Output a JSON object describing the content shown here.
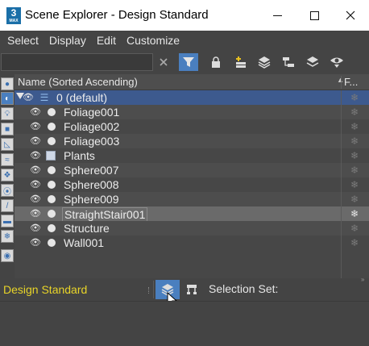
{
  "window": {
    "title": "Scene Explorer - Design Standard",
    "app_icon_text": "3",
    "app_icon_subtext": "MAX",
    "controls": [
      "minimize-icon",
      "maximize-icon",
      "close-icon"
    ]
  },
  "menu": [
    "Select",
    "Display",
    "Edit",
    "Customize"
  ],
  "toolbar": {
    "search_value": "",
    "buttons": [
      "clear-search-icon",
      "filter-icon",
      "lock-icon",
      "add-to-layer-icon",
      "layer-stack-icon",
      "hierarchy-icon",
      "sort-icon",
      "eye-filter-icon"
    ]
  },
  "columns": {
    "name": "Name (Sorted Ascending)",
    "sort_indicator": "▲",
    "freeze": "F..."
  },
  "rows": [
    {
      "label": "0 (default)",
      "type": "layer"
    },
    {
      "label": "Foliage001",
      "type": "object"
    },
    {
      "label": "Foliage002",
      "type": "object"
    },
    {
      "label": "Foliage003",
      "type": "object"
    },
    {
      "label": "Plants",
      "type": "group"
    },
    {
      "label": "Sphere007",
      "type": "object"
    },
    {
      "label": "Sphere008",
      "type": "object"
    },
    {
      "label": "Sphere009",
      "type": "object"
    },
    {
      "label": "StraightStair001",
      "type": "object"
    },
    {
      "label": "Structure",
      "type": "object"
    },
    {
      "label": "Wall001",
      "type": "object"
    }
  ],
  "bottom": {
    "workspace": "Design Standard",
    "selection_label": "Selection Set:"
  },
  "colors": {
    "accent": "#4a7fbf",
    "layer_row": "#3d5a8e",
    "workspace_text": "#e8d428"
  }
}
